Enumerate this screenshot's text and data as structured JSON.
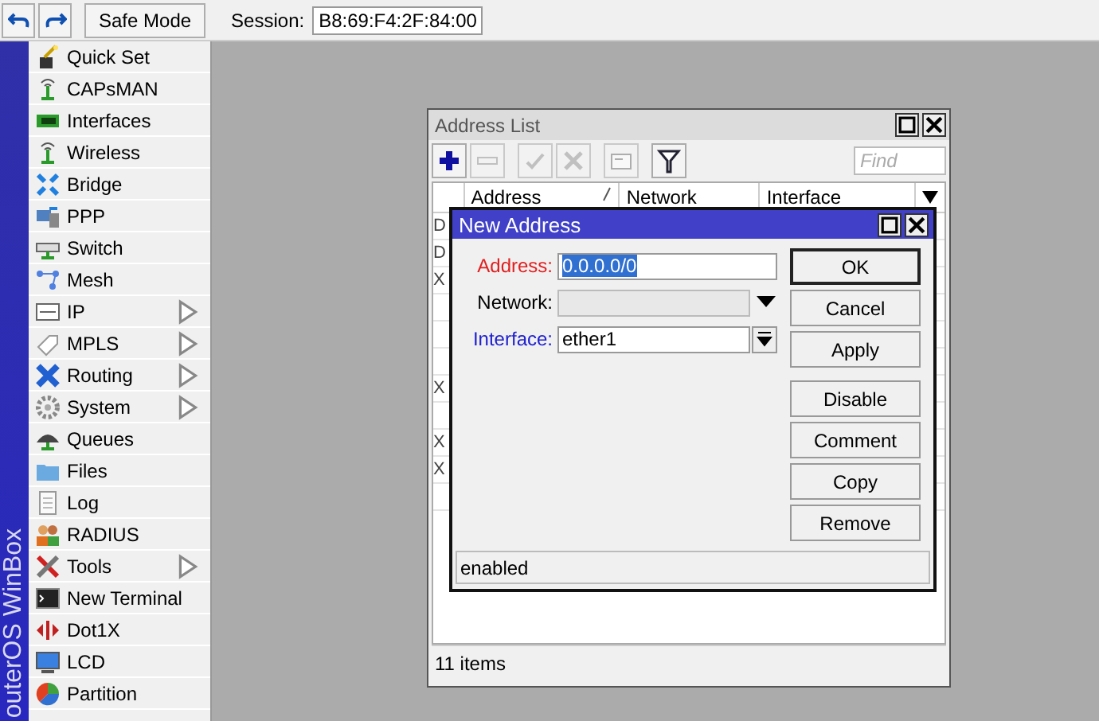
{
  "toolbar": {
    "safe_mode": "Safe Mode",
    "session_label": "Session:",
    "session_value": "B8:69:F4:2F:84:00"
  },
  "sidebar": {
    "brand": "outerOS WinBox",
    "items": [
      {
        "label": "Quick Set",
        "submenu": false
      },
      {
        "label": "CAPsMAN",
        "submenu": false
      },
      {
        "label": "Interfaces",
        "submenu": false
      },
      {
        "label": "Wireless",
        "submenu": false
      },
      {
        "label": "Bridge",
        "submenu": false
      },
      {
        "label": "PPP",
        "submenu": false
      },
      {
        "label": "Switch",
        "submenu": false
      },
      {
        "label": "Mesh",
        "submenu": false
      },
      {
        "label": "IP",
        "submenu": true
      },
      {
        "label": "MPLS",
        "submenu": true
      },
      {
        "label": "Routing",
        "submenu": true
      },
      {
        "label": "System",
        "submenu": true
      },
      {
        "label": "Queues",
        "submenu": false
      },
      {
        "label": "Files",
        "submenu": false
      },
      {
        "label": "Log",
        "submenu": false
      },
      {
        "label": "RADIUS",
        "submenu": false
      },
      {
        "label": "Tools",
        "submenu": true
      },
      {
        "label": "New Terminal",
        "submenu": false
      },
      {
        "label": "Dot1X",
        "submenu": false
      },
      {
        "label": "LCD",
        "submenu": false
      },
      {
        "label": "Partition",
        "submenu": false
      }
    ]
  },
  "address_list": {
    "title": "Address List",
    "tools": [
      {
        "kind": "add",
        "disabled": false
      },
      {
        "kind": "remove",
        "disabled": true
      },
      {
        "kind": "enable",
        "disabled": true
      },
      {
        "kind": "disable",
        "disabled": true
      },
      {
        "kind": "comment",
        "disabled": true
      },
      {
        "kind": "filter",
        "disabled": false
      }
    ],
    "find": {
      "placeholder": "Find"
    },
    "columns": [
      {
        "label": "Address",
        "sorted": true
      },
      {
        "label": "Network",
        "sorted": false
      },
      {
        "label": "Interface",
        "sorted": false
      }
    ],
    "rows": [
      {
        "flag": "D"
      },
      {
        "flag": "D"
      },
      {
        "flag": "X"
      },
      {
        "flag": null
      },
      {
        "flag": null
      },
      {
        "flag": null
      },
      {
        "flag": "X"
      },
      {
        "flag": null
      },
      {
        "flag": "X"
      },
      {
        "flag": "X"
      },
      {
        "flag": null
      }
    ],
    "status": "11 items"
  },
  "new_address": {
    "title": "New Address",
    "fields": [
      {
        "label": "Address:",
        "color": "#e02020",
        "kind": "text",
        "value": "0.0.0.0/0",
        "selected": true,
        "disabled": false
      },
      {
        "label": "Network:",
        "color": "#000000",
        "kind": "combo",
        "disabled": true
      },
      {
        "label": "Interface:",
        "color": "#2020d0",
        "kind": "select",
        "value": "ether1",
        "selected": false,
        "disabled": false
      }
    ],
    "buttons": [
      {
        "label": "OK",
        "default": true
      },
      {
        "label": "Cancel",
        "default": false
      },
      {
        "label": "Apply",
        "default": false
      },
      {
        "label": "Disable",
        "default": false
      },
      {
        "label": "Comment",
        "default": false
      },
      {
        "label": "Copy",
        "default": false
      },
      {
        "label": "Remove",
        "default": false
      }
    ],
    "status": "enabled"
  }
}
